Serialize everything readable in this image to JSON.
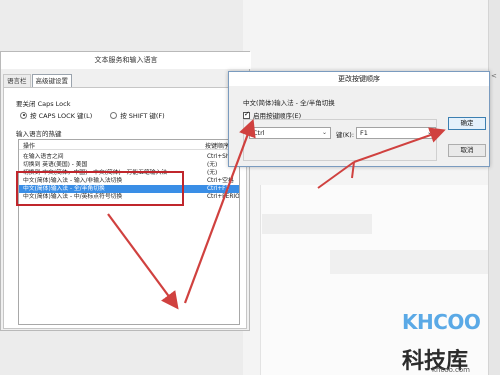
{
  "dialog_main": {
    "title": "文本服务和输入语言",
    "tabs": [
      {
        "label": "语言栏",
        "active": false
      },
      {
        "label": "高级键设置",
        "active": true
      }
    ],
    "caps_lock_label": "要关闭 Caps Lock",
    "radio_caps": "按 CAPS LOCK 键(L)",
    "radio_shift": "按 SHIFT 键(F)",
    "hotkeys_label": "输入语言的热键",
    "list_header_action": "操作",
    "list_header_keys": "按键顺序",
    "rows": [
      {
        "op": "在输入语言之间",
        "key": "Ctrl+Shift",
        "selected": false
      },
      {
        "op": "切换到 英语(美国) - 美国",
        "key": "(无)",
        "selected": false
      },
      {
        "op": "切换到 中文(简体，中国) - 中文(简体) - 万能五笔输入法",
        "key": "(无)",
        "selected": false
      },
      {
        "op": "中文(简体)输入法 - 输入/非输入法切换",
        "key": "Ctrl+空格",
        "selected": false
      },
      {
        "op": "中文(简体)输入法 - 全/半角切换",
        "key": "Ctrl+F1",
        "selected": true
      },
      {
        "op": "中文(简体)输入法 - 中/英标点符号切换",
        "key": "Ctrl+PERIOD",
        "selected": false
      }
    ]
  },
  "dialog_hotkey": {
    "title": "更改按键顺序",
    "language_text": "中文(简体)输入法 - 全/半角切换",
    "enable_checkbox": "启用按键顺序(E)",
    "modifier_value": "Ctrl",
    "key_label": "键(K):",
    "key_value": "F1",
    "ok_label": "确定",
    "cancel_label": "取消"
  },
  "watermark": {
    "brand": "KHCOO",
    "chinese": "科技库",
    "url": "khcoo.com"
  },
  "colors": {
    "selection": "#3a8ee6",
    "highlight_box": "#c0262c",
    "arrow": "#d0413f",
    "brand_blue": "#5aa9e6"
  }
}
